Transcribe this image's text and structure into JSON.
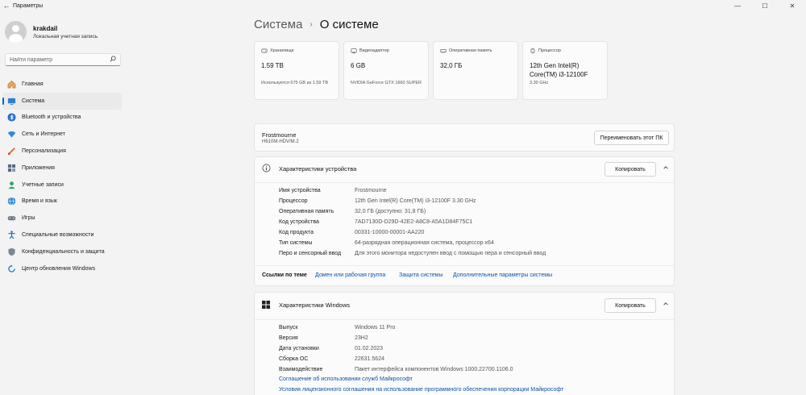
{
  "window": {
    "title": "Параметры",
    "back": "←",
    "minimize": "—",
    "maximize": "☐",
    "close": "✕"
  },
  "profile": {
    "name": "krakdail",
    "subtitle": "Локальная учетная запись"
  },
  "search": {
    "placeholder": "Найти параметр"
  },
  "nav": [
    {
      "label": "Главная",
      "icon": "home-icon"
    },
    {
      "label": "Система",
      "icon": "system-icon",
      "active": true
    },
    {
      "label": "Bluetooth и устройства",
      "icon": "bluetooth-icon"
    },
    {
      "label": "Сеть и Интернет",
      "icon": "wifi-icon"
    },
    {
      "label": "Персонализация",
      "icon": "brush-icon"
    },
    {
      "label": "Приложения",
      "icon": "apps-icon"
    },
    {
      "label": "Учетные записи",
      "icon": "accounts-icon"
    },
    {
      "label": "Время и язык",
      "icon": "globe-icon"
    },
    {
      "label": "Игры",
      "icon": "gamepad-icon"
    },
    {
      "label": "Специальные возможности",
      "icon": "accessibility-icon"
    },
    {
      "label": "Конфиденциальность и защита",
      "icon": "shield-icon"
    },
    {
      "label": "Центр обновления Windows",
      "icon": "update-icon"
    }
  ],
  "breadcrumb": {
    "parent": "Система",
    "separator": "›",
    "current": "О системе"
  },
  "tiles": [
    {
      "label": "Хранилище",
      "value": "1.59 TB",
      "sub": "Используется 675 GB из 1.59 TB",
      "icon": "storage-icon"
    },
    {
      "label": "Видеоадаптер",
      "value": "6 GB",
      "sub": "NVIDIA GeForce GTX 1660 SUPER",
      "icon": "gpu-icon"
    },
    {
      "label": "Оперативная память",
      "value": "32,0 ГБ",
      "sub": "",
      "icon": "ram-icon"
    },
    {
      "label": "Процессор",
      "value": "12th Gen Intel(R) Core(TM) i3-12100F",
      "sub": "3.30 GHz",
      "icon": "cpu-icon"
    }
  ],
  "pc": {
    "name": "Frostmourne",
    "model": "H610M-HDV/M.2",
    "rename_label": "Переименовать этот ПК"
  },
  "device_specs": {
    "title": "Характеристики устройства",
    "copy_label": "Копировать",
    "rows": [
      {
        "k": "Имя устройства",
        "v": "Frostmourne"
      },
      {
        "k": "Процессор",
        "v": "12th Gen Intel(R) Core(TM) i3-12100F   3.30 GHz"
      },
      {
        "k": "Оперативная память",
        "v": "32,0 ГБ (доступно: 31,8 ГБ)"
      },
      {
        "k": "Код устройства",
        "v": "7AD7130D-D29D-42E2-A8C8-A5A1D84F75C1"
      },
      {
        "k": "Код продукта",
        "v": "00331-10000-00001-AA220"
      },
      {
        "k": "Тип системы",
        "v": "64-разрядная операционная система, процессор x64"
      },
      {
        "k": "Перо и сенсорный ввод",
        "v": "Для этого монитора недоступен ввод с помощью пера и сенсорный ввод"
      }
    ]
  },
  "related": {
    "label": "Ссылки по теме",
    "links": [
      "Домен или рабочая группа",
      "Защита системы",
      "Дополнительные параметры системы"
    ]
  },
  "windows_specs": {
    "title": "Характеристики Windows",
    "copy_label": "Копировать",
    "rows": [
      {
        "k": "Выпуск",
        "v": "Windows 11 Pro"
      },
      {
        "k": "Версия",
        "v": "23H2"
      },
      {
        "k": "Дата установки",
        "v": "01.02.2023"
      },
      {
        "k": "Сборка ОС",
        "v": "22631.5624"
      },
      {
        "k": "Взаимодействие",
        "v": "Пакет интерфейса компонентов Windows 1000.22700.1106.0"
      }
    ],
    "links": [
      "Соглашение об использовании служб Майкрософт",
      "Условия лицензионного соглашения на использование программного обеспечения корпорации Майкрософт"
    ]
  },
  "colors": {
    "accent": "#0067c0",
    "link": "#0a54a8",
    "background": "#f3f3f3",
    "card": "#fbfbfb"
  }
}
